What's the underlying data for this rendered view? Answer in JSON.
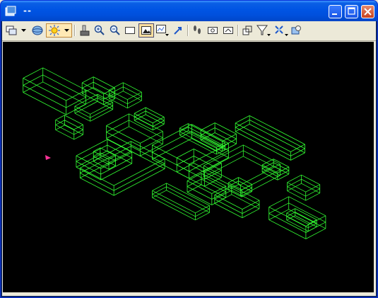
{
  "window": {
    "title": "--",
    "accent": "#0054e3",
    "buttons": {
      "minimize": "minimize-icon",
      "maximize": "maximize-icon",
      "close": "close-icon"
    }
  },
  "toolbar": {
    "tools": [
      "view-layout-icon",
      "dropdown-arrow-icon",
      "globe-icon",
      "lighting-icon",
      "print-icon",
      "zoom-in-icon",
      "zoom-out-icon",
      "window-area-icon",
      "fit-view-icon",
      "view-settings-icon",
      "rotate-view-icon",
      "walk-icon",
      "camera-front-icon",
      "camera-back-icon",
      "clip-volume-icon",
      "filter-icon",
      "display-style-icon",
      "render-icon"
    ],
    "active_tool": "fit-view-icon"
  },
  "viewport": {
    "background": "#000000",
    "wire_color": "#33ff33",
    "marker_color": "#ff3399",
    "content": "3d-wireframe-building-model"
  }
}
